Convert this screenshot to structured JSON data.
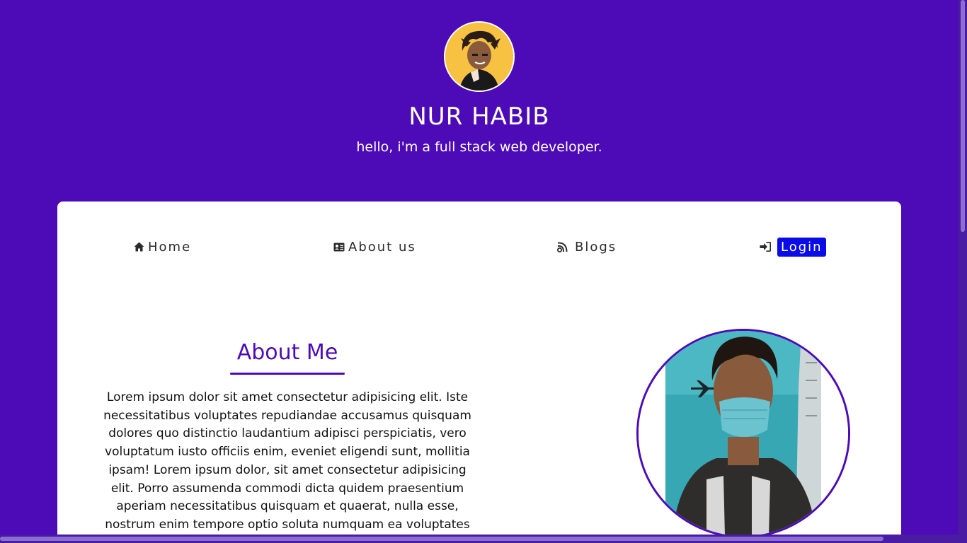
{
  "header": {
    "name": "NUR HABIB",
    "tagline": "hello, i'm a full stack web developer."
  },
  "nav": {
    "home": {
      "label": "Home",
      "icon": "home-icon"
    },
    "about": {
      "label": "About us",
      "icon": "id-card-icon"
    },
    "blogs": {
      "label": "Blogs",
      "icon": "rss-icon"
    },
    "login": {
      "label": "Login",
      "icon": "sign-in-icon"
    }
  },
  "about": {
    "title": "About Me",
    "text": "Lorem ipsum dolor sit amet consectetur adipisicing elit. Iste necessitatibus voluptates repudiandae accusamus quisquam dolores quo distinctio laudantium adipisci perspiciatis, vero voluptatum iusto officiis enim, eveniet eligendi sunt, mollitia ipsam! Lorem ipsum dolor, sit amet consectetur adipisicing elit. Porro assumenda commodi dicta quidem praesentium aperiam necessitatibus quisquam et quaerat, nulla esse, nostrum enim tempore optio soluta numquam ea voluptates"
  },
  "colors": {
    "background": "#4c0bb6",
    "card": "#ffffff",
    "accent": "#4c0bb6",
    "login_button": "#0a0ce8"
  }
}
